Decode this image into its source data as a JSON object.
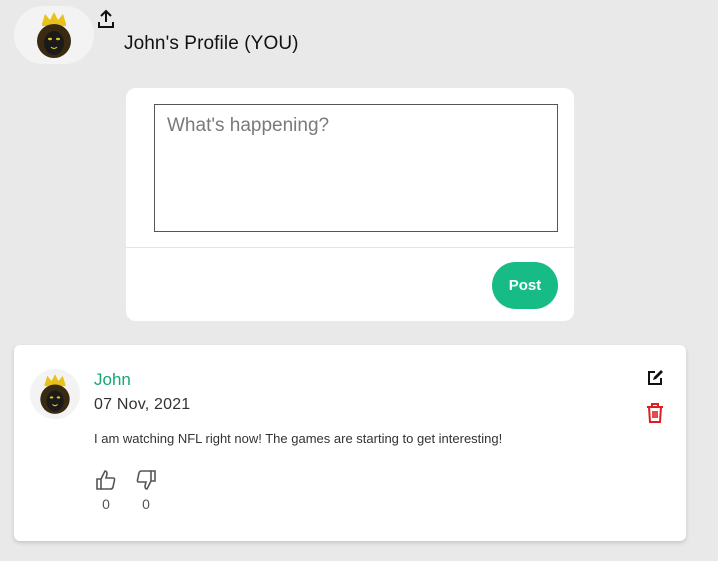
{
  "profile": {
    "title": "John's Profile (YOU)",
    "avatar_icon": "lion-king-avatar",
    "upload_icon": "upload-icon"
  },
  "composer": {
    "placeholder": "What's happening?",
    "value": "",
    "post_label": "Post"
  },
  "post": {
    "author": "John",
    "date": "07 Nov, 2021",
    "text": "I am watching NFL right now! The games are starting to get interesting!",
    "likes": "0",
    "dislikes": "0",
    "edit_icon": "edit-icon",
    "delete_icon": "trash-icon"
  },
  "colors": {
    "accent": "#16bb85",
    "author": "#17a57a",
    "delete": "#e01e1e",
    "background": "#e9e9e9"
  }
}
